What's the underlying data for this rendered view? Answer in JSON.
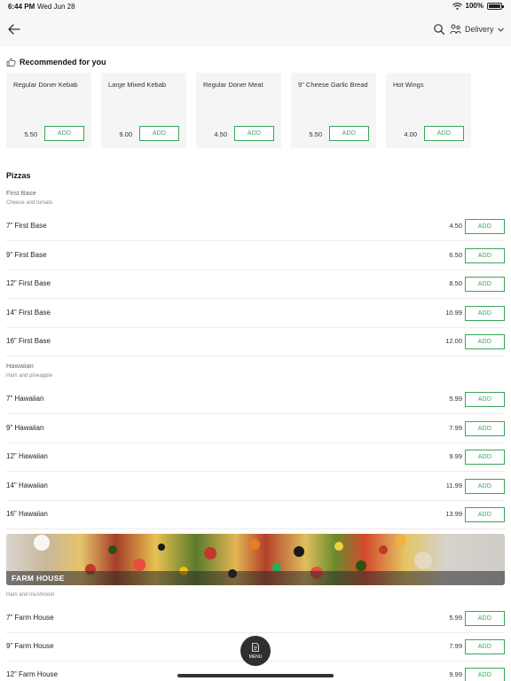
{
  "status": {
    "time": "6:44 PM",
    "date": "Wed Jun 28",
    "battery": "100%"
  },
  "nav": {
    "delivery_label": "Delivery"
  },
  "recommended": {
    "title": "Recommended for you",
    "items": [
      {
        "name": "Regular Doner Kebab",
        "price": "5.50"
      },
      {
        "name": "Large Mixed Kebab",
        "price": "9.00"
      },
      {
        "name": "Regular Doner Meat",
        "price": "4.50"
      },
      {
        "name": "9\" Cheese Garlic Bread",
        "price": "5.50"
      },
      {
        "name": "Hot Wings",
        "price": "4.00"
      }
    ]
  },
  "add_label": "ADD",
  "menu": {
    "section": "Pizzas",
    "first_base": {
      "title": "First Base",
      "subtitle": "Cheese and tomato",
      "items": [
        {
          "name": "7\" First Base",
          "price": "4.50"
        },
        {
          "name": "9\" First Base",
          "price": "6.50"
        },
        {
          "name": "12\" First Base",
          "price": "8.50"
        },
        {
          "name": "14\" First Base",
          "price": "10.99"
        },
        {
          "name": "16\" First Base",
          "price": "12.00"
        }
      ]
    },
    "hawaiian": {
      "title": "Hawaiian",
      "subtitle": "Ham and pineapple",
      "items": [
        {
          "name": "7\" Hawaiian",
          "price": "5.99"
        },
        {
          "name": "9\" Hawaiian",
          "price": "7.99"
        },
        {
          "name": "12\" Hawaiian",
          "price": "9.99"
        },
        {
          "name": "14\" Hawaiian",
          "price": "11.99"
        },
        {
          "name": "16\" Hawaiian",
          "price": "13.99"
        }
      ]
    },
    "farm_house": {
      "banner_label": "FARM HOUSE",
      "subtitle": "Ham and mushroom",
      "items": [
        {
          "name": "7\" Farm House",
          "price": "5.99"
        },
        {
          "name": "9\" Farm House",
          "price": "7.99"
        },
        {
          "name": "12\" Farm House",
          "price": "9.99"
        }
      ]
    }
  },
  "fab": {
    "label": "MENU"
  },
  "colors": {
    "accent": "#3ba55c",
    "fab": "#2f2f2f"
  },
  "icons": [
    "wifi-icon",
    "battery-icon",
    "back-arrow-icon",
    "search-icon",
    "delivery-person-icon",
    "chevron-down-icon",
    "thumbs-up-icon",
    "menu-document-icon"
  ]
}
